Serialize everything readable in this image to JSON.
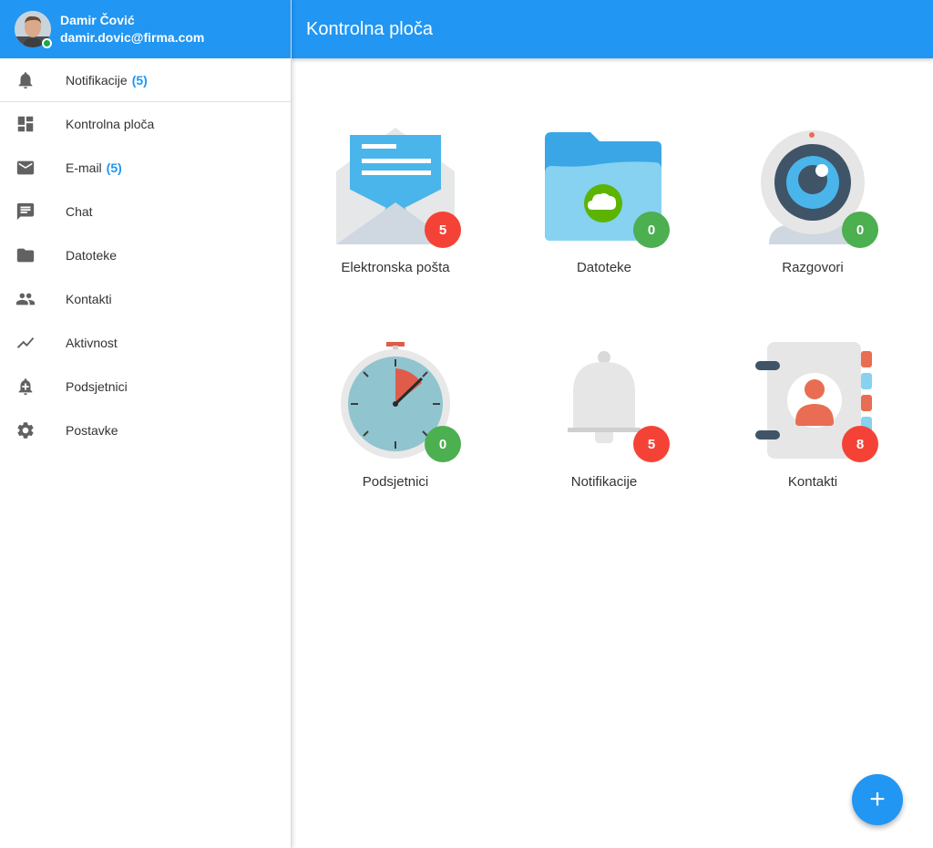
{
  "user": {
    "name": "Damir Čović",
    "email": "damir.dovic@firma.com",
    "status_color": "#1aa84a"
  },
  "header": {
    "title": "Kontrolna ploča"
  },
  "sidebar": {
    "items": [
      {
        "label": "Notifikacije",
        "count": "(5)",
        "icon": "bell-icon"
      },
      {
        "label": "Kontrolna ploča",
        "count": "",
        "icon": "dashboard-icon"
      },
      {
        "label": "E-mail",
        "count": "(5)",
        "icon": "mail-icon"
      },
      {
        "label": "Chat",
        "count": "",
        "icon": "chat-icon"
      },
      {
        "label": "Datoteke",
        "count": "",
        "icon": "folder-icon"
      },
      {
        "label": "Kontakti",
        "count": "",
        "icon": "people-icon"
      },
      {
        "label": "Aktivnost",
        "count": "",
        "icon": "trending-icon"
      },
      {
        "label": "Podsjetnici",
        "count": "",
        "icon": "alarm-add-icon"
      },
      {
        "label": "Postavke",
        "count": "",
        "icon": "gear-icon"
      }
    ]
  },
  "tiles": [
    {
      "label": "Elektronska pošta",
      "badge": "5",
      "badge_color": "#f44336",
      "icon": "envelope-icon"
    },
    {
      "label": "Datoteke",
      "badge": "0",
      "badge_color": "#4caf50",
      "icon": "cloud-folder-icon"
    },
    {
      "label": "Razgovori",
      "badge": "0",
      "badge_color": "#4caf50",
      "icon": "webcam-icon"
    },
    {
      "label": "Podsjetnici",
      "badge": "0",
      "badge_color": "#4caf50",
      "icon": "stopwatch-icon"
    },
    {
      "label": "Notifikacije",
      "badge": "5",
      "badge_color": "#f44336",
      "icon": "bell-icon"
    },
    {
      "label": "Kontakti",
      "badge": "8",
      "badge_color": "#f44336",
      "icon": "address-book-icon"
    }
  ],
  "fab": {
    "label": "+"
  },
  "colors": {
    "primary": "#2196f3",
    "danger": "#f44336",
    "success": "#4caf50"
  }
}
